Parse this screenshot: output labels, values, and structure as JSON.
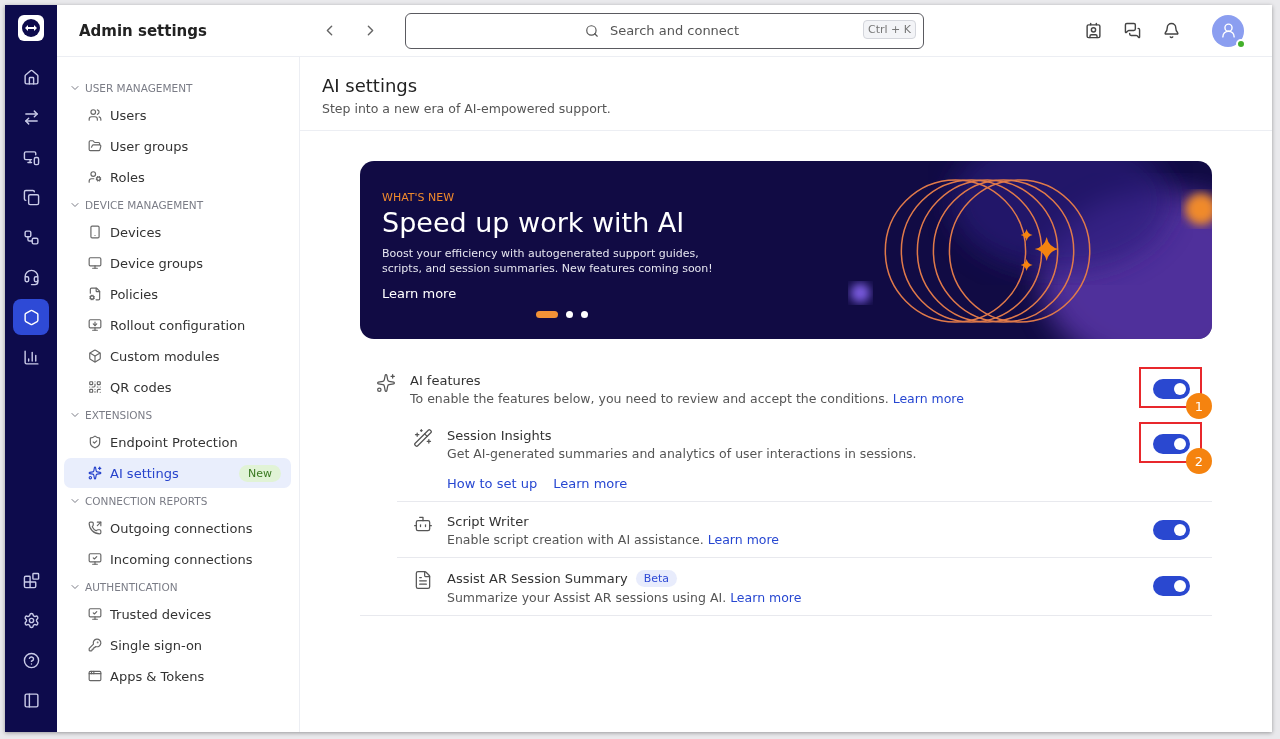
{
  "rail": {
    "items": [
      {
        "selected": false
      },
      {
        "selected": false
      },
      {
        "selected": false
      },
      {
        "selected": false
      },
      {
        "selected": false
      },
      {
        "selected": false
      },
      {
        "selected": true
      },
      {
        "selected": false
      }
    ],
    "bottom": [
      {
        "selected": false
      },
      {
        "selected": false
      },
      {
        "selected": false
      },
      {
        "selected": false
      }
    ]
  },
  "header": {
    "title": "Admin settings"
  },
  "topbar": {
    "search": {
      "placeholder": "Search and connect",
      "shortcut": "Ctrl + K"
    }
  },
  "sidebar": {
    "sections": [
      {
        "title": "USER MANAGEMENT",
        "expanded": true,
        "items": [
          {
            "label": "Users",
            "selected": false
          },
          {
            "label": "User groups",
            "selected": false
          },
          {
            "label": "Roles",
            "selected": false
          }
        ]
      },
      {
        "title": "DEVICE MANAGEMENT",
        "expanded": true,
        "items": [
          {
            "label": "Devices",
            "selected": false
          },
          {
            "label": "Device groups",
            "selected": false
          },
          {
            "label": "Policies",
            "selected": false
          },
          {
            "label": "Rollout configuration",
            "selected": false
          },
          {
            "label": "Custom modules",
            "selected": false
          },
          {
            "label": "QR codes",
            "selected": false
          }
        ]
      },
      {
        "title": "EXTENSIONS",
        "expanded": true,
        "items": [
          {
            "label": "Endpoint Protection",
            "selected": false
          },
          {
            "label": "AI settings",
            "selected": true,
            "badge": "New"
          }
        ]
      },
      {
        "title": "CONNECTION REPORTS",
        "expanded": true,
        "items": [
          {
            "label": "Outgoing connections",
            "selected": false
          },
          {
            "label": "Incoming connections",
            "selected": false
          }
        ]
      },
      {
        "title": "AUTHENTICATION",
        "expanded": true,
        "items": [
          {
            "label": "Trusted devices",
            "selected": false
          },
          {
            "label": "Single sign-on",
            "selected": false
          },
          {
            "label": "Apps & Tokens",
            "selected": false
          }
        ]
      }
    ]
  },
  "page": {
    "title": "AI settings",
    "subtitle": "Step into a new era of AI-empowered support."
  },
  "banner": {
    "eyebrow": "WHAT'S NEW",
    "title": "Speed up work with AI",
    "text": "Boost your efficiency with autogenerated support guides, scripts, and session summaries. New features coming soon!",
    "link": "Learn more",
    "dots": [
      {
        "selected": true
      },
      {
        "selected": false
      },
      {
        "selected": false
      }
    ]
  },
  "features": [
    {
      "title": "AI features",
      "text": "To enable the features below, you need to review and accept the conditions.",
      "link": "Learn more",
      "on": true,
      "callout": "1",
      "children": [
        {
          "title": "Session Insights",
          "text": "Get AI-generated summaries and analytics of user interactions in sessions.",
          "links": [
            "How to set up",
            "Learn more"
          ],
          "on": true,
          "callout": "2"
        },
        {
          "title": "Script Writer",
          "text": "Enable script creation with AI assistance.",
          "link": "Learn more",
          "on": true
        },
        {
          "title": "Assist AR Session Summary",
          "badge": "Beta",
          "text": "Summarize your Assist AR sessions using AI.",
          "link": "Learn more",
          "on": true
        }
      ]
    }
  ]
}
